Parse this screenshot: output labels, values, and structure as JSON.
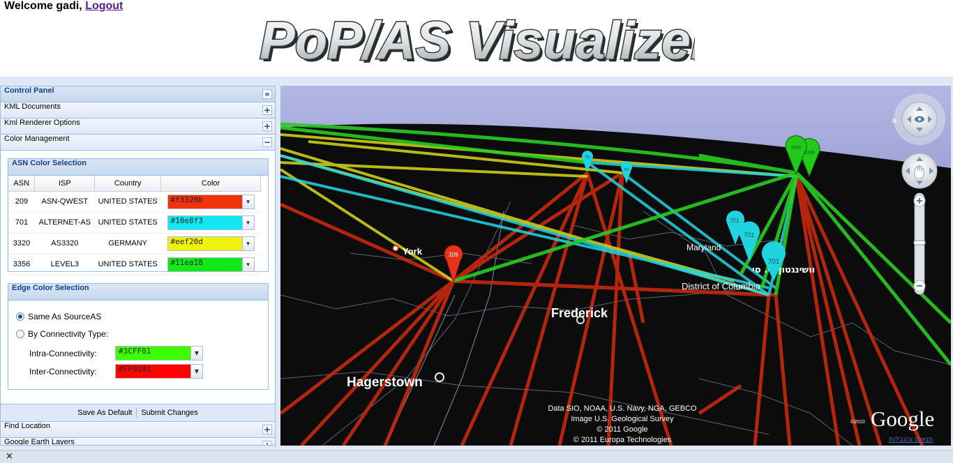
{
  "header": {
    "welcome_text": "Welcome gadi,",
    "logout_label": "Logout",
    "logo_text": "PoP/AS Visualizer"
  },
  "control_panel": {
    "title": "Control Panel",
    "collapse_icon": "«",
    "sections": [
      {
        "label": "KML Documents",
        "icon": "+"
      },
      {
        "label": "Kml Renderer Options",
        "icon": "+"
      },
      {
        "label": "Color Management",
        "icon": "−"
      }
    ],
    "asn_color_selection": {
      "title": "ASN Color Selection",
      "columns": [
        "ASN",
        "ISP",
        "Country",
        "Color"
      ],
      "rows": [
        {
          "asn": "209",
          "isp": "ASN-QWEST",
          "country": "UNITED STATES",
          "color": "#f3320b"
        },
        {
          "asn": "701",
          "isp": "ALTERNET-AS",
          "country": "UNITED STATES",
          "color": "#10e8f3"
        },
        {
          "asn": "3320",
          "isp": "AS3320",
          "country": "GERMANY",
          "color": "#eef20d"
        },
        {
          "asn": "3356",
          "isp": "LEVEL3",
          "country": "UNITED STATES",
          "color": "#11ea18"
        }
      ]
    },
    "edge_color_selection": {
      "title": "Edge Color Selection",
      "option_same": "Same As SourceAS",
      "option_by_type": "By Connectivity Type:",
      "selected": "same",
      "intra_label": "Intra-Connectivity:",
      "intra_value": "#3CFF01",
      "inter_label": "Inter-Connectivity:",
      "inter_value": "#FF0101"
    },
    "footer": {
      "save_default": "Save As Default",
      "submit": "Submit Changes"
    },
    "lower_sections": [
      {
        "label": "Find Location",
        "icon": "+"
      },
      {
        "label": "Google Earth Layers",
        "icon": "+"
      }
    ]
  },
  "map": {
    "place_labels": {
      "york": "York",
      "maryland": "Maryland",
      "hebrew_label": "וושינגטון די. סי",
      "dc": "District of Columbia",
      "frederick": "Frederick",
      "hagerstown": "Hagerstown"
    },
    "markers": [
      "209",
      "701",
      "701",
      "701",
      "701",
      "701",
      "3356",
      "3356"
    ],
    "attribution": [
      "Data SIO, NOAA, U.S. Navy, NGA, GEBCO",
      "Image U.S. Geological Survey",
      "© 2011 Google",
      "© 2011 Europa Technologies"
    ],
    "google_logo": "Google",
    "google_year": "©2010",
    "terms_link": "תנאים והגבלות",
    "compass_letter": "N"
  },
  "statusbar": {
    "close_icon": "×"
  }
}
